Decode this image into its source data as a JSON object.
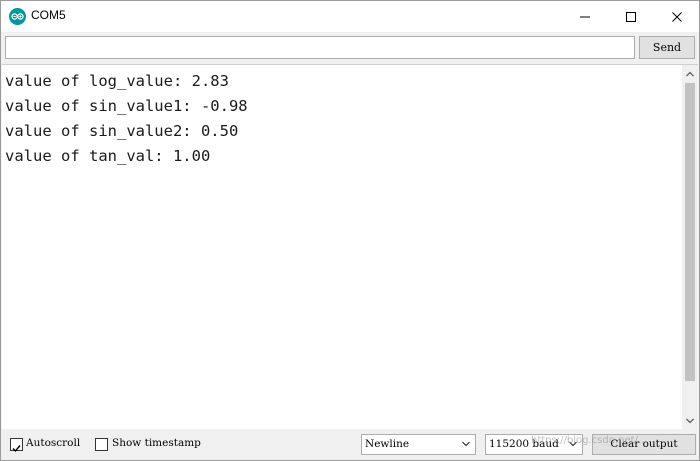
{
  "window": {
    "title": "COM5"
  },
  "send": {
    "input_value": "",
    "button_label": "Send"
  },
  "output": {
    "lines": [
      "value of log_value: 2.83",
      "value of sin_value1: -0.98",
      "value of sin_value2: 0.50",
      "value of tan_val: 1.00"
    ]
  },
  "bottom": {
    "autoscroll_label": "Autoscroll",
    "autoscroll_checked": true,
    "timestamp_label": "Show timestamp",
    "timestamp_checked": false,
    "line_ending": "Newline",
    "baud_rate": "115200 baud",
    "clear_label": "Clear output"
  },
  "watermark": "https://blog.csdn.net/...",
  "colors": {
    "app_icon": "#00979d",
    "window_bg": "#f0f0f0"
  },
  "icons": [
    "arduino-icon",
    "minimize-icon",
    "maximize-icon",
    "close-icon",
    "chevron-down-icon",
    "scroll-up-icon",
    "scroll-down-icon"
  ]
}
